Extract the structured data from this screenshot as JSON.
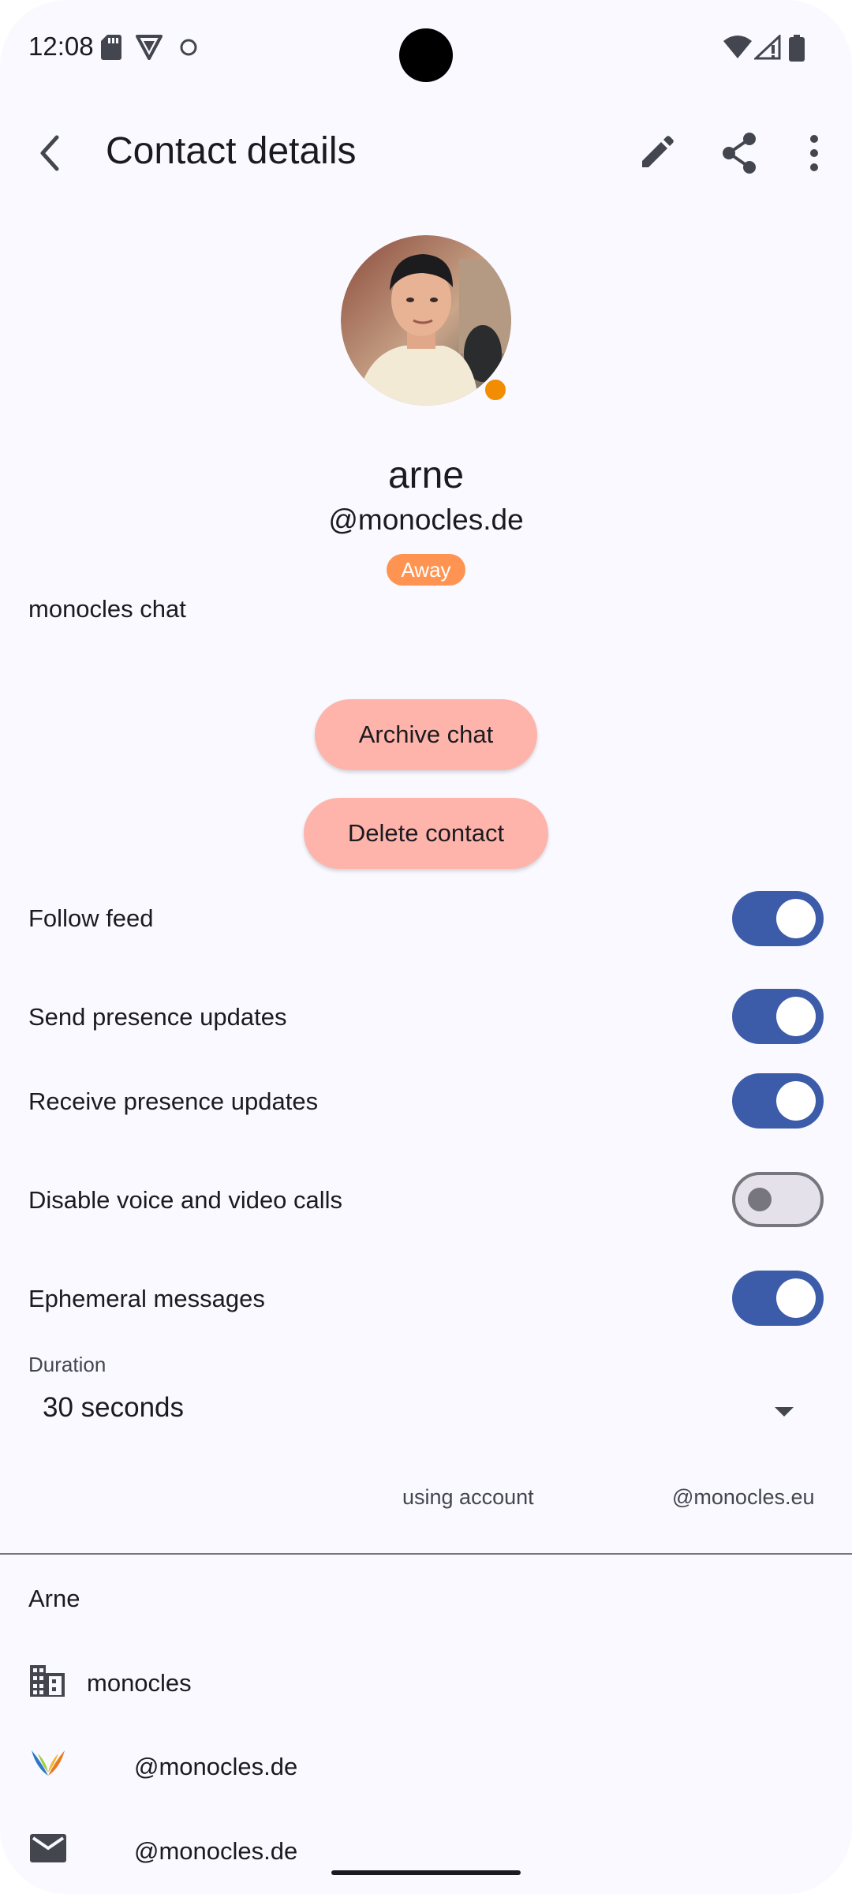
{
  "status_bar": {
    "time": "12:08",
    "icons": [
      "sd-card-icon",
      "vpn-icon",
      "circle-icon",
      "wifi-icon",
      "signal-icon",
      "battery-icon"
    ]
  },
  "app_bar": {
    "title": "Contact details",
    "actions": [
      "edit-icon",
      "share-icon",
      "more-vert-icon"
    ]
  },
  "contact": {
    "name": "arne",
    "jid": "@monocles.de",
    "status_badge": "Away",
    "client": "monocles chat"
  },
  "buttons": {
    "archive": "Archive chat",
    "delete": "Delete contact"
  },
  "settings": [
    {
      "label": "Follow feed",
      "enabled": true
    },
    {
      "label": "Send presence updates",
      "enabled": true
    },
    {
      "label": "Receive presence updates",
      "enabled": true
    },
    {
      "label": "Disable voice and video calls",
      "enabled": false
    },
    {
      "label": "Ephemeral messages",
      "enabled": true
    }
  ],
  "duration": {
    "label": "Duration",
    "value": "30 seconds"
  },
  "account": {
    "label": "using account",
    "value": "@monocles.eu"
  },
  "details": {
    "full_name": "Arne",
    "organization": "monocles",
    "xmpp": "@monocles.de",
    "email": "@monocles.de"
  },
  "colors": {
    "accent": "#3c5ba9",
    "danger_button": "#ffb4ab",
    "away": "#ff9452",
    "presence_dot": "#f28c00",
    "background": "#f9f9ff"
  }
}
